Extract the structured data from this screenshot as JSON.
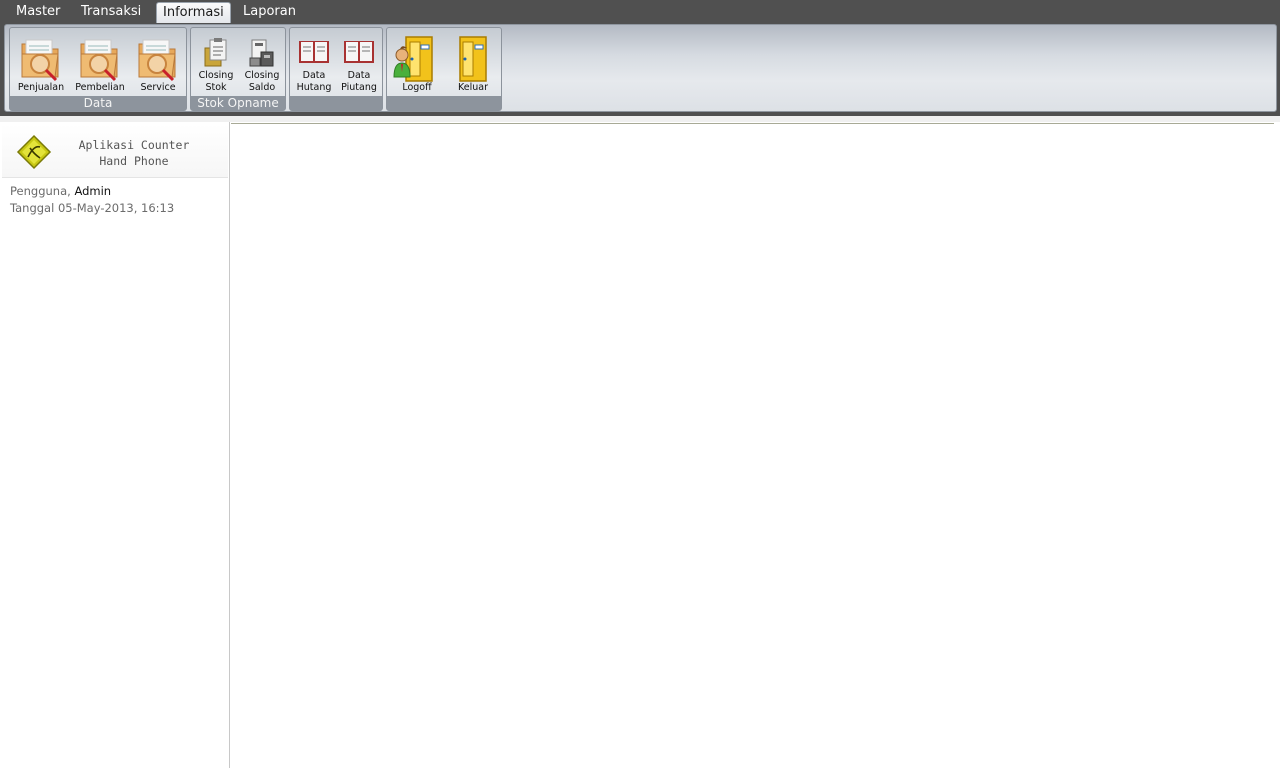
{
  "tabs": [
    {
      "label": "Master"
    },
    {
      "label": "Transaksi"
    },
    {
      "label": "Informasi",
      "active": true
    },
    {
      "label": "Laporan"
    }
  ],
  "ribbon": {
    "groups": [
      {
        "label": "Data",
        "buttons": [
          "Penjualan",
          "Pembelian",
          "Service"
        ]
      },
      {
        "label": "Stok Opname",
        "buttons": [
          "Closing\nStok",
          "Closing\nSaldo"
        ]
      },
      {
        "label": "",
        "buttons": [
          "Data\nHutang",
          "Data\nPiutang"
        ]
      },
      {
        "label": "",
        "buttons": [
          "Logoff",
          "Keluar"
        ]
      }
    ],
    "icons": [
      "folder-search-icon",
      "folder-search-icon",
      "folder-search-icon",
      "clipboard-icon",
      "stack-icon",
      "ledger-icon",
      "ledger-icon",
      "user-door-icon",
      "door-icon"
    ]
  },
  "sidebar": {
    "app_title_line1": "Aplikasi Counter",
    "app_title_line2": "Hand Phone",
    "user_label": "Pengguna,",
    "user_value": "Admin",
    "date_label": "Tanggal",
    "date_value": "05-May-2013, 16:13"
  },
  "colors": {
    "tabbar": "#505050",
    "group_label": "#8d949d",
    "accent_gold": "#f2c21b"
  }
}
